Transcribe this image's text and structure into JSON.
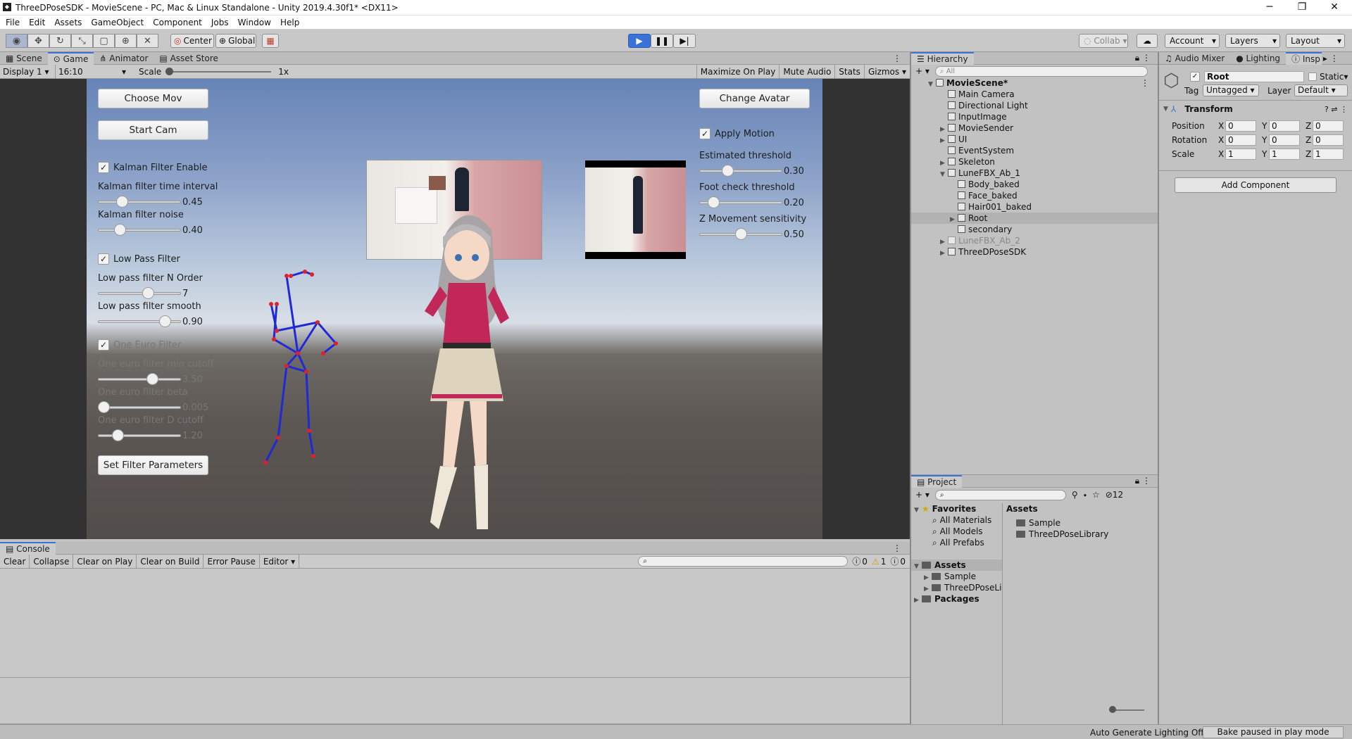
{
  "window": {
    "title": "ThreeDPoseSDK - MovieScene - PC, Mac & Linux Standalone - Unity 2019.4.30f1* <DX11>",
    "min": "─",
    "max": "❐",
    "close": "✕"
  },
  "menu": [
    "File",
    "Edit",
    "Assets",
    "GameObject",
    "Component",
    "Jobs",
    "Window",
    "Help"
  ],
  "toolbar": {
    "pivot": "Center",
    "space": "Global",
    "collab": "Collab",
    "account": "Account",
    "layers": "Layers",
    "layout": "Layout"
  },
  "tabs": {
    "scene": "Scene",
    "game": "Game",
    "animator": "Animator",
    "asset_store": "Asset Store"
  },
  "gamebar": {
    "display": "Display 1",
    "aspect": "16:10",
    "scale_label": "Scale",
    "scale_value": "1x",
    "maximize": "Maximize On Play",
    "mute": "Mute Audio",
    "stats": "Stats",
    "gizmos": "Gizmos"
  },
  "game": {
    "choose_mov": "Choose Mov",
    "start_cam": "Start Cam",
    "change_avatar": "Change Avatar",
    "set_filter": "Set Filter Parameters",
    "kalman_enable": "Kalman Filter Enable",
    "kalman_interval_label": "Kalman filter time interval",
    "kalman_interval_value": "0.45",
    "kalman_interval_level": 0.26,
    "kalman_noise_label": "Kalman filter noise",
    "kalman_noise_value": "0.40",
    "kalman_noise_level": 0.23,
    "low_pass": "Low Pass Filter",
    "lp_order_label": "Low pass filter N Order",
    "lp_order_value": "7",
    "lp_order_level": 0.62,
    "lp_smooth_label": "Low pass filter smooth",
    "lp_smooth_value": "0.90",
    "lp_smooth_level": 0.86,
    "one_euro": "One Euro Filter",
    "oe_min_label": "One euro filter min cutoff",
    "oe_min_value": "3.50",
    "oe_min_level": 0.68,
    "oe_beta_label": "One euro filter beta",
    "oe_beta_value": "0.005",
    "oe_beta_level": 0.0,
    "oe_d_label": "One euro filter D cutoff",
    "oe_d_value": "1.20",
    "oe_d_level": 0.2,
    "apply_motion": "Apply Motion",
    "est_label": "Estimated threshold",
    "est_value": "0.30",
    "est_level": 0.32,
    "foot_label": "Foot check threshold",
    "foot_value": "0.20",
    "foot_level": 0.12,
    "zmove_label": "Z Movement sensitivity",
    "zmove_value": "0.50",
    "zmove_level": 0.5
  },
  "hierarchy": {
    "title": "Hierarchy",
    "search_placeholder": "All",
    "scene": "MovieScene*",
    "items": [
      "Main Camera",
      "Directional Light",
      "InputImage",
      "MovieSender",
      "UI",
      "EventSystem",
      "Skeleton",
      "LuneFBX_Ab_1",
      "Body_baked",
      "Face_baked",
      "Hair001_baked",
      "Root",
      "secondary",
      "LuneFBX_Ab_2",
      "ThreeDPoseSDK"
    ]
  },
  "inspector": {
    "tabs": [
      "Audio Mixer",
      "Lighting",
      "Insp"
    ],
    "object": "Root",
    "static": "Static",
    "tag_label": "Tag",
    "tag": "Untagged",
    "layer_label": "Layer",
    "layer": "Default",
    "transform": "Transform",
    "rows": [
      {
        "label": "Position",
        "x": "0",
        "y": "0",
        "z": "0"
      },
      {
        "label": "Rotation",
        "x": "0",
        "y": "0",
        "z": "0"
      },
      {
        "label": "Scale",
        "x": "1",
        "y": "1",
        "z": "1"
      }
    ],
    "axes": [
      "X",
      "Y",
      "Z"
    ],
    "add_component": "Add Component"
  },
  "project": {
    "title": "Project",
    "hidden_count": "12",
    "favorites": "Favorites",
    "fav_items": [
      "All Materials",
      "All Models",
      "All Prefabs"
    ],
    "assets": "Assets",
    "asset_tree": [
      "Sample",
      "ThreeDPoseLil"
    ],
    "packages": "Packages",
    "assets_header": "Assets",
    "asset_files": [
      "Sample",
      "ThreeDPoseLibrary"
    ]
  },
  "console": {
    "title": "Console",
    "clear": "Clear",
    "collapse": "Collapse",
    "clear_on_play": "Clear on Play",
    "clear_on_build": "Clear on Build",
    "error_pause": "Error Pause",
    "editor": "Editor",
    "errors": "0",
    "warnings": "1",
    "logs": "0"
  },
  "status": {
    "lighting": "Auto Generate Lighting Off",
    "bake": "Bake paused in play mode"
  }
}
